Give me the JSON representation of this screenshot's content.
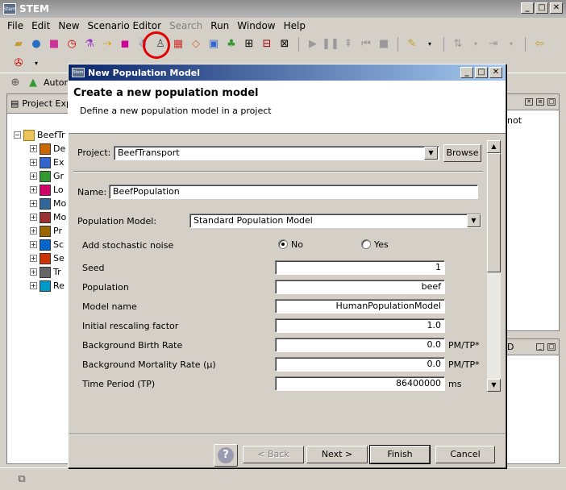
{
  "app": {
    "title": "STEM",
    "icon_label": "Stem",
    "menu": [
      "File",
      "Edit",
      "New",
      "Scenario Editor",
      "Search",
      "Run",
      "Window",
      "Help"
    ]
  },
  "perspective": {
    "label": "Autom"
  },
  "explorer": {
    "tab_label": "Project Exp",
    "root": "BeefTr",
    "items": [
      {
        "label": "De",
        "color": "#cc6600"
      },
      {
        "label": "Ex",
        "color": "#3366cc"
      },
      {
        "label": "Gr",
        "color": "#339933"
      },
      {
        "label": "Lo",
        "color": "#cc0066"
      },
      {
        "label": "Mo",
        "color": "#336699"
      },
      {
        "label": "Mo",
        "color": "#993333"
      },
      {
        "label": "Pr",
        "color": "#996600"
      },
      {
        "label": "Sc",
        "color": "#0066cc"
      },
      {
        "label": "Se",
        "color": "#cc3300"
      },
      {
        "label": "Tr",
        "color": "#666666"
      },
      {
        "label": "Re",
        "color": "#0099cc"
      }
    ]
  },
  "right_panel": {
    "text": "not",
    "tab_glyph": "D"
  },
  "dialog": {
    "title": "New Population Model",
    "icon_label": "Stem",
    "header_title": "Create a new population model",
    "header_subtitle": "Define a new population model in a project",
    "project_label": "Project:",
    "project_value": "BeefTransport",
    "browse_label": "Browse",
    "name_label": "Name:",
    "name_value": "BeefPopulation",
    "model_label": "Population Model:",
    "model_value": "Standard Population Model",
    "stochastic_label": "Add stochastic noise",
    "radio_no": "No",
    "radio_yes": "Yes",
    "radio_selected": "No",
    "params": [
      {
        "label": "Seed",
        "value": "1",
        "unit": ""
      },
      {
        "label": "Population",
        "value": "beef",
        "unit": ""
      },
      {
        "label": "Model name",
        "value": "HumanPopulationModel",
        "unit": ""
      },
      {
        "label": "Initial rescaling factor",
        "value": "1.0",
        "unit": ""
      },
      {
        "label": "Background Birth Rate",
        "value": "0.0",
        "unit": "PM/TP*"
      },
      {
        "label": "Background Mortality Rate (µ)",
        "value": "0.0",
        "unit": "PM/TP*"
      },
      {
        "label": "Time Period (TP)",
        "value": "86400000",
        "unit": "ms"
      }
    ],
    "help_glyph": "?",
    "back_label": "< Back",
    "next_label": "Next >",
    "finish_label": "Finish",
    "cancel_label": "Cancel"
  }
}
